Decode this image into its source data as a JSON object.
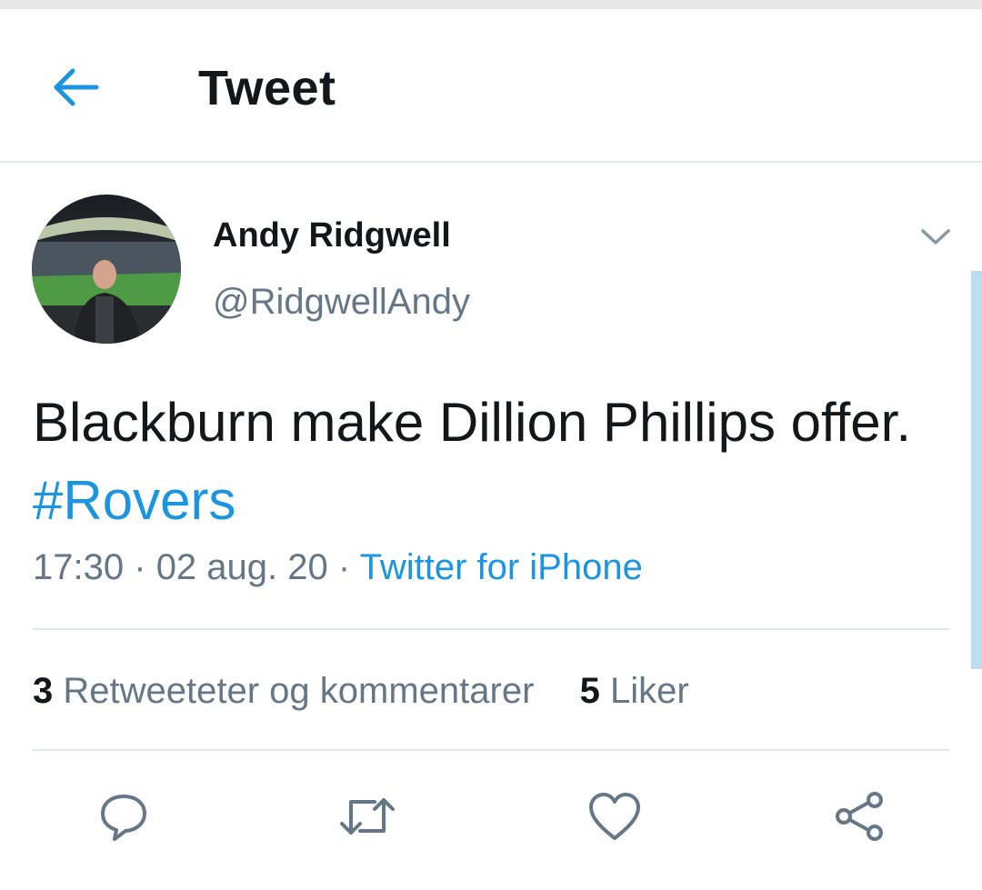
{
  "header": {
    "back_icon": "arrow-left-icon",
    "title": "Tweet"
  },
  "colors": {
    "accent": "#1b95e0",
    "text": "#14171a",
    "muted": "#657786",
    "divider": "#e1e8ed"
  },
  "tweet": {
    "author": {
      "display_name": "Andy Ridgwell",
      "handle": "@RidgwellAndy"
    },
    "text": "Blackburn make Dillion Phillips offer.",
    "hashtag": "#Rovers",
    "time": "17:30",
    "date": "02 aug. 20",
    "separator": "·",
    "source": "Twitter for iPhone"
  },
  "stats": {
    "retweets_count": "3",
    "retweets_label": "Retweeteter og kommentarer",
    "likes_count": "5",
    "likes_label": "Liker"
  },
  "actions": [
    {
      "icon": "reply-icon"
    },
    {
      "icon": "retweet-icon"
    },
    {
      "icon": "like-icon"
    },
    {
      "icon": "share-icon"
    }
  ]
}
